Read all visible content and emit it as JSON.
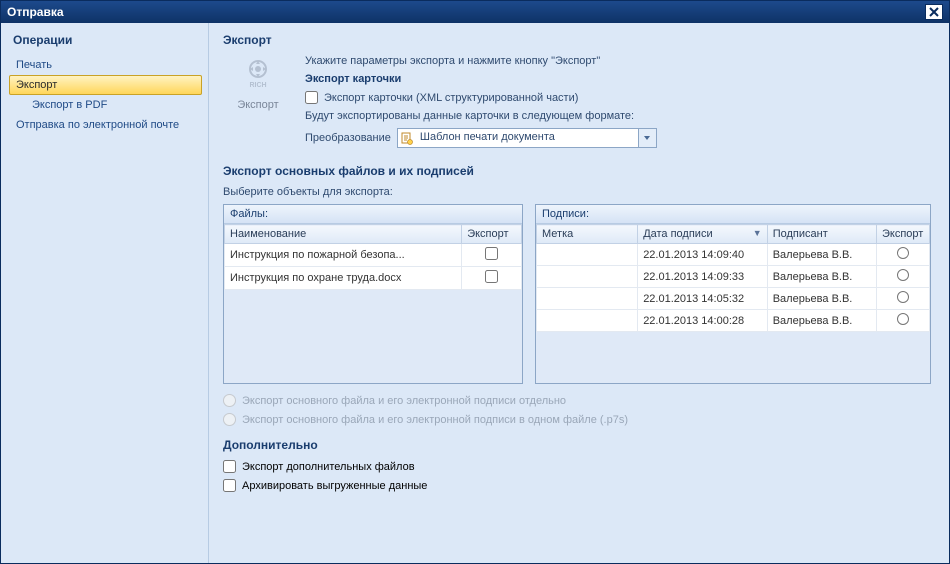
{
  "window": {
    "title": "Отправка"
  },
  "sidebar": {
    "title": "Операции",
    "items": [
      {
        "label": "Печать"
      },
      {
        "label": "Экспорт"
      },
      {
        "label": "Экспорт в PDF"
      },
      {
        "label": "Отправка по электронной почте"
      }
    ],
    "selectedIndex": 1
  },
  "main": {
    "title": "Экспорт",
    "icon_caption": "Экспорт",
    "hint": "Укажите параметры экспорта и нажмите кнопку \"Экспорт\"",
    "card": {
      "heading": "Экспорт карточки",
      "checkbox_label": "Экспорт карточки (XML структурированной части)",
      "note": "Будут экспортированы данные карточки в следующем формате:",
      "transform_label": "Преобразование",
      "transform_value": "Шаблон печати документа"
    },
    "files_section": {
      "heading": "Экспорт основных файлов и их подписей",
      "choose_label": "Выберите объекты для экспорта:",
      "files_panel": {
        "title": "Файлы:",
        "columns": [
          "Наименование",
          "Экспорт"
        ],
        "rows": [
          {
            "name": "Инструкция по пожарной безопа...",
            "export": false
          },
          {
            "name": "Инструкция по охране труда.docx",
            "export": false
          }
        ]
      },
      "sigs_panel": {
        "title": "Подписи:",
        "columns": [
          "Метка",
          "Дата подписи",
          "Подписант",
          "Экспорт"
        ],
        "rows": [
          {
            "label": "",
            "date": "22.01.2013 14:09:40",
            "signer": "Валерьева В.В."
          },
          {
            "label": "",
            "date": "22.01.2013 14:09:33",
            "signer": "Валерьева В.В."
          },
          {
            "label": "",
            "date": "22.01.2013 14:05:32",
            "signer": "Валерьева В.В."
          },
          {
            "label": "",
            "date": "22.01.2013 14:00:28",
            "signer": "Валерьева В.В."
          }
        ]
      },
      "radio_separate": "Экспорт основного файла и его электронной подписи отдельно",
      "radio_combined": "Экспорт основного файла и его электронной подписи в одном файле (.p7s)"
    },
    "additional": {
      "heading": "Дополнительно",
      "export_extra": "Экспорт дополнительных  файлов",
      "archive": "Архивировать выгруженные данные"
    }
  }
}
